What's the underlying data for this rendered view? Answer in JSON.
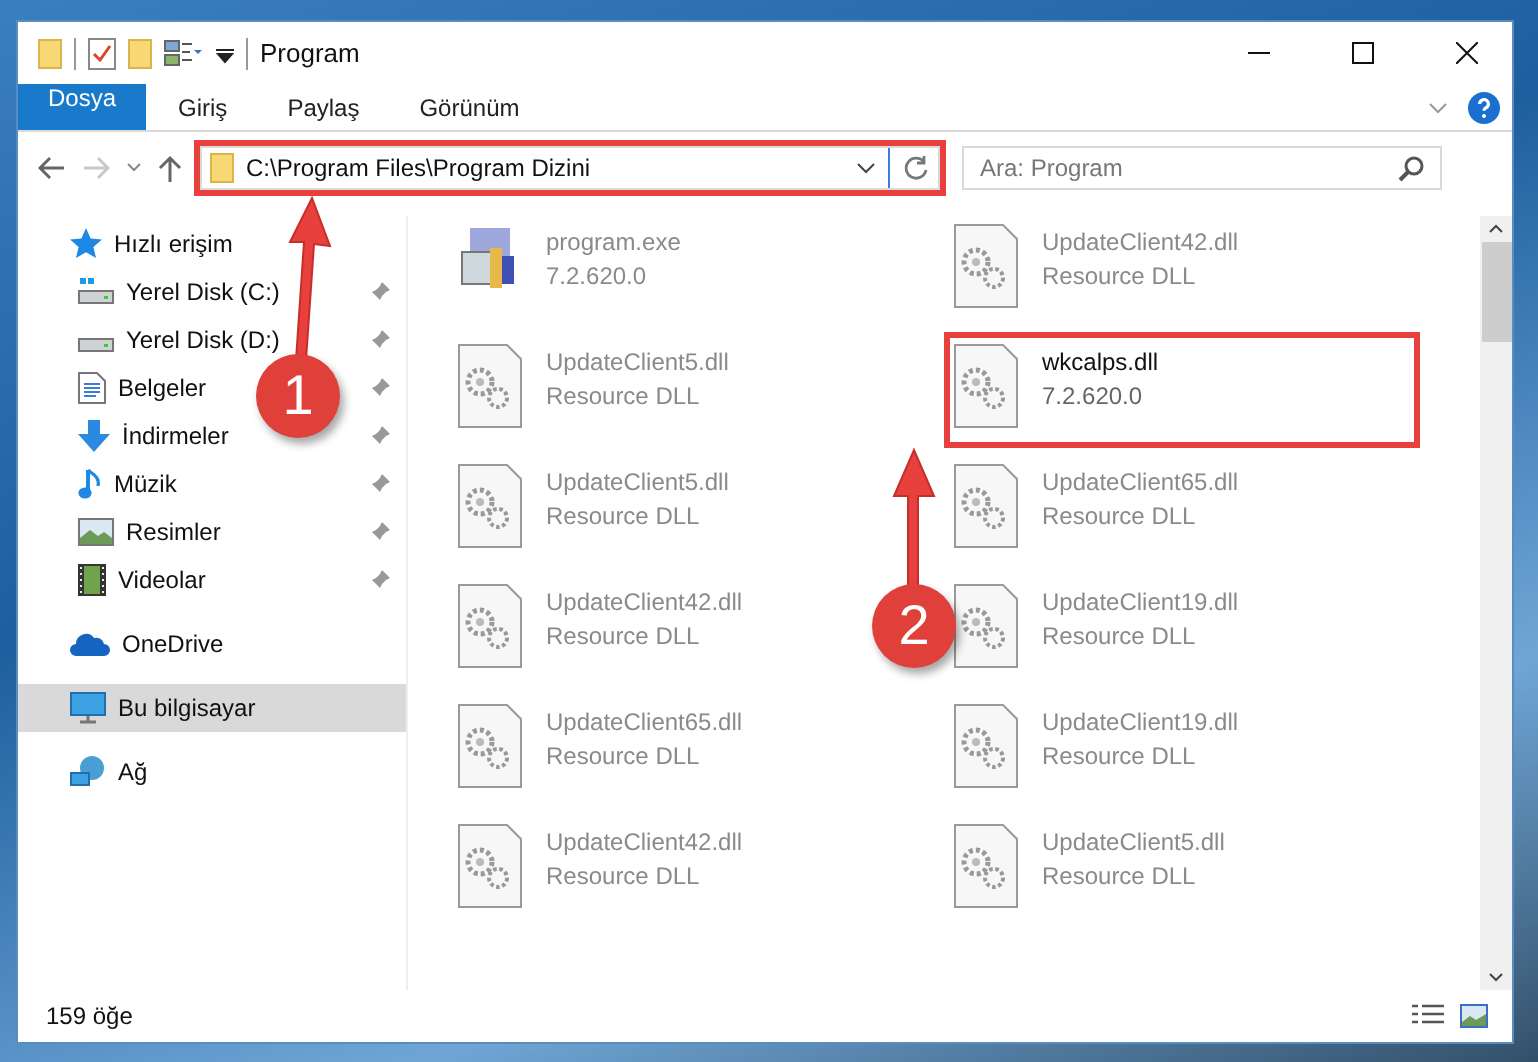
{
  "window": {
    "title": "Program"
  },
  "ribbon": {
    "tabs": [
      {
        "label": "Dosya",
        "kind": "file",
        "selected": false
      },
      {
        "label": "Giriş",
        "kind": "tab",
        "selected": false
      },
      {
        "label": "Paylaş",
        "kind": "tab",
        "selected": false
      },
      {
        "label": "Görünüm",
        "kind": "tab",
        "selected": false
      }
    ]
  },
  "address": {
    "path": "C:\\Program Files\\Program Dizini",
    "highlighted": true
  },
  "search": {
    "placeholder": "Ara: Program"
  },
  "sidebar": {
    "items": [
      {
        "label": "Hızlı erişim",
        "selected": false,
        "children": [
          {
            "label": "Yerel Disk (C:)",
            "pinned": true,
            "selected": false
          },
          {
            "label": "Yerel Disk (D:)",
            "pinned": true,
            "selected": false
          },
          {
            "label": "Belgeler",
            "pinned": true,
            "selected": false
          },
          {
            "label": "İndirmeler",
            "pinned": true,
            "selected": false
          },
          {
            "label": "Müzik",
            "pinned": true,
            "selected": false
          },
          {
            "label": "Resimler",
            "pinned": true,
            "selected": false
          },
          {
            "label": "Videolar",
            "pinned": true,
            "selected": false
          }
        ]
      },
      {
        "label": "OneDrive",
        "selected": false
      },
      {
        "label": "Bu bilgisayar",
        "selected": true
      },
      {
        "label": "Ağ",
        "selected": false
      }
    ]
  },
  "files": [
    {
      "name": "program.exe",
      "detail": "7.2.620.0",
      "kind": "exe",
      "highlighted": false
    },
    {
      "name": "UpdateClient42.dll",
      "detail": "Resource DLL",
      "kind": "dll",
      "highlighted": false
    },
    {
      "name": "UpdateClient5.dll",
      "detail": "Resource DLL",
      "kind": "dll",
      "highlighted": false
    },
    {
      "name": "wkcalps.dll",
      "detail": "7.2.620.0",
      "kind": "dll",
      "highlighted": true
    },
    {
      "name": "UpdateClient5.dll",
      "detail": "Resource DLL",
      "kind": "dll",
      "highlighted": false
    },
    {
      "name": "UpdateClient65.dll",
      "detail": "Resource DLL",
      "kind": "dll",
      "highlighted": false
    },
    {
      "name": "UpdateClient42.dll",
      "detail": "Resource DLL",
      "kind": "dll",
      "highlighted": false
    },
    {
      "name": "UpdateClient19.dll",
      "detail": "Resource DLL",
      "kind": "dll",
      "highlighted": false
    },
    {
      "name": "UpdateClient65.dll",
      "detail": "Resource DLL",
      "kind": "dll",
      "highlighted": false
    },
    {
      "name": "UpdateClient19.dll",
      "detail": "Resource DLL",
      "kind": "dll",
      "highlighted": false
    },
    {
      "name": "UpdateClient42.dll",
      "detail": "Resource DLL",
      "kind": "dll",
      "highlighted": false
    },
    {
      "name": "UpdateClient5.dll",
      "detail": "Resource DLL",
      "kind": "dll",
      "highlighted": false
    }
  ],
  "callouts": [
    {
      "label": "1"
    },
    {
      "label": "2"
    }
  ],
  "status_bar": {
    "item_count": "159 öğe"
  }
}
